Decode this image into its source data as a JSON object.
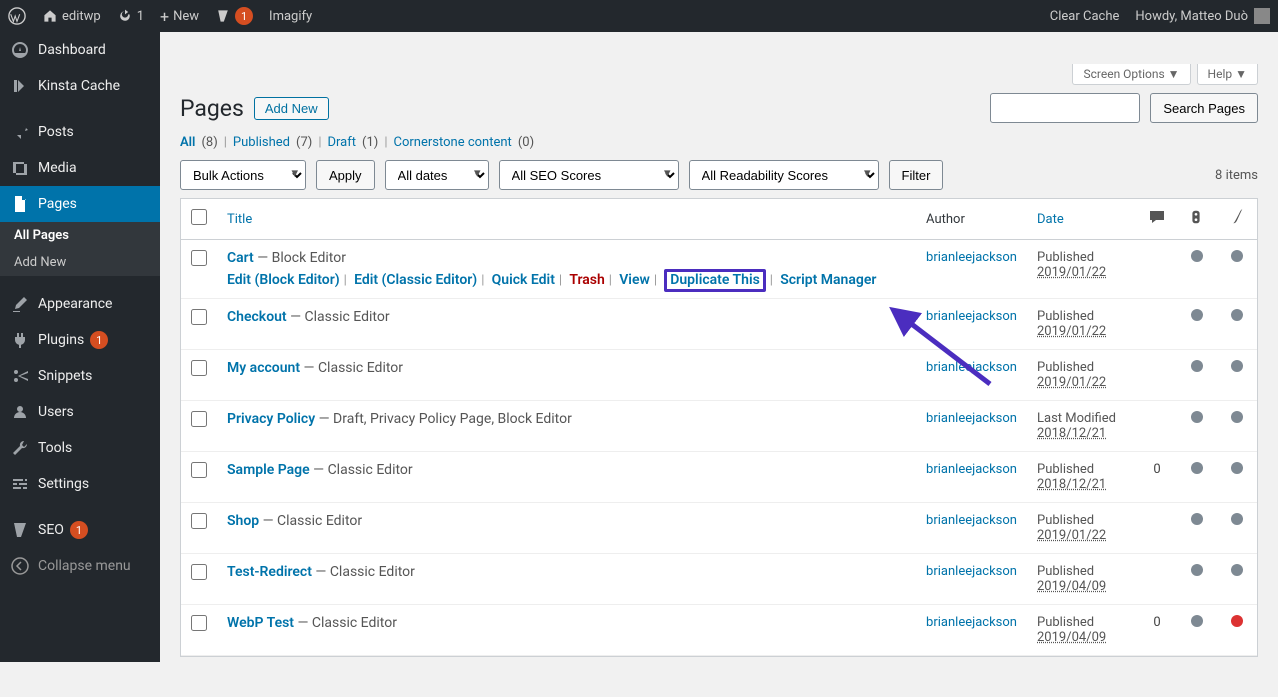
{
  "adminbar": {
    "site_name": "editwp",
    "refresh_count": "1",
    "new_label": "New",
    "comments_count": "1",
    "imagify_label": "Imagify",
    "clear_cache": "Clear Cache",
    "howdy": "Howdy, Matteo Duò"
  },
  "sidebar": {
    "dashboard": "Dashboard",
    "kinsta_cache": "Kinsta Cache",
    "posts": "Posts",
    "media": "Media",
    "pages": "Pages",
    "all_pages": "All Pages",
    "add_new": "Add New",
    "appearance": "Appearance",
    "plugins": "Plugins",
    "plugins_count": "1",
    "snippets": "Snippets",
    "users": "Users",
    "tools": "Tools",
    "settings": "Settings",
    "seo": "SEO",
    "seo_count": "1",
    "collapse": "Collapse menu"
  },
  "screenmeta": {
    "screen_options": "Screen Options",
    "help": "Help"
  },
  "heading": {
    "title": "Pages",
    "add_new": "Add New"
  },
  "filters": {
    "all": "All",
    "all_count": "(8)",
    "published": "Published",
    "published_count": "(7)",
    "draft": "Draft",
    "draft_count": "(1)",
    "cornerstone": "Cornerstone content",
    "cornerstone_count": "(0)"
  },
  "tablenav": {
    "bulk_actions": "Bulk Actions",
    "apply": "Apply",
    "all_dates": "All dates",
    "all_seo": "All SEO Scores",
    "all_readability": "All Readability Scores",
    "filter": "Filter",
    "items_count": "8 items",
    "search_btn": "Search Pages"
  },
  "columns": {
    "title": "Title",
    "author": "Author",
    "date": "Date"
  },
  "row_actions": {
    "edit_block": "Edit (Block Editor)",
    "edit_classic": "Edit (Classic Editor)",
    "quick_edit": "Quick Edit",
    "trash": "Trash",
    "view": "View",
    "duplicate": "Duplicate This",
    "script_mgr": "Script Manager"
  },
  "rows": [
    {
      "title": "Cart",
      "suffix": " — Block Editor",
      "author": "brianleejackson",
      "status": "Published",
      "date": "2019/01/22",
      "comments": "",
      "show_actions": true
    },
    {
      "title": "Checkout",
      "suffix": " — Classic Editor",
      "author": "brianleejackson",
      "status": "Published",
      "date": "2019/01/22",
      "comments": ""
    },
    {
      "title": "My account",
      "suffix": " — Classic Editor",
      "author": "brianleejackson",
      "status": "Published",
      "date": "2019/01/22",
      "comments": ""
    },
    {
      "title": "Privacy Policy",
      "suffix": " — Draft, Privacy Policy Page, Block Editor",
      "author": "brianleejackson",
      "status": "Last Modified",
      "date": "2018/12/21",
      "comments": ""
    },
    {
      "title": "Sample Page",
      "suffix": " — Classic Editor",
      "author": "brianleejackson",
      "status": "Published",
      "date": "2018/12/21",
      "comments": "0"
    },
    {
      "title": "Shop",
      "suffix": " — Classic Editor",
      "author": "brianleejackson",
      "status": "Published",
      "date": "2019/01/22",
      "comments": ""
    },
    {
      "title": "Test-Redirect",
      "suffix": " — Classic Editor",
      "author": "brianleejackson",
      "status": "Published",
      "date": "2019/04/09",
      "comments": ""
    },
    {
      "title": "WebP Test",
      "suffix": " — Classic Editor",
      "author": "brianleejackson",
      "status": "Published",
      "date": "2019/04/09",
      "comments": "0",
      "red_dot": true
    }
  ]
}
